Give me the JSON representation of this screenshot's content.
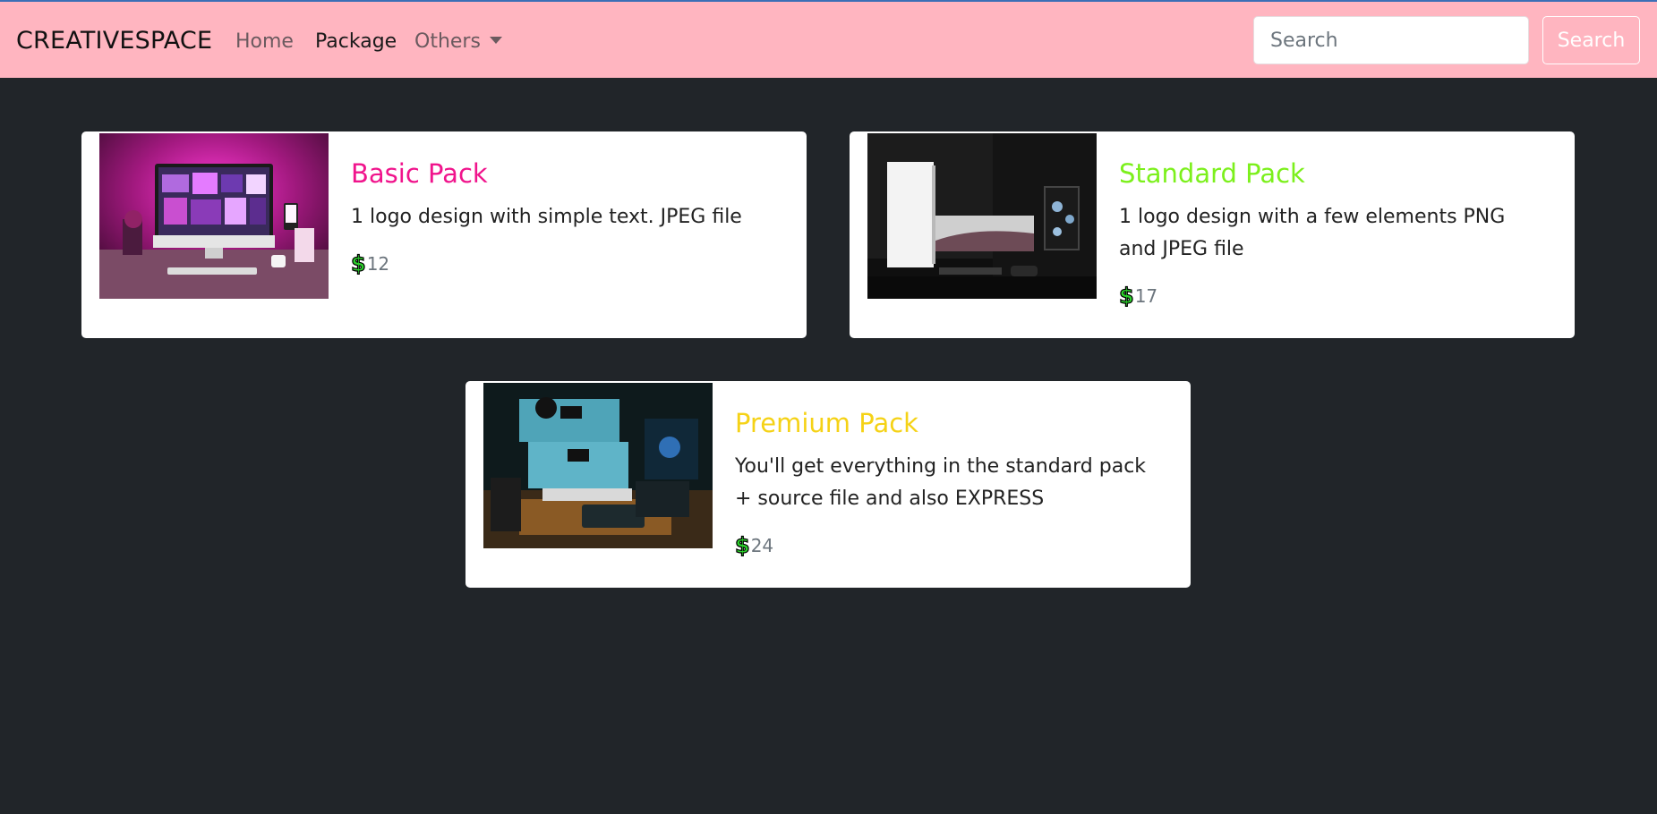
{
  "navbar": {
    "brand": "CREATIVESPACE",
    "links": [
      {
        "label": "Home"
      },
      {
        "label": "Package"
      },
      {
        "label": "Others"
      }
    ],
    "search_placeholder": "Search",
    "search_button": "Search",
    "background": "#ffb5c0"
  },
  "cards": [
    {
      "title": "Basic Pack",
      "title_color": "#f0148c",
      "description": "1 logo design with simple text. JPEG file",
      "currency_icon": "dollar-icon",
      "price": "12"
    },
    {
      "title": "Standard Pack",
      "title_color": "#7cf01c",
      "description": "1 logo design with a few elements PNG and JPEG file",
      "currency_icon": "dollar-icon",
      "price": "17"
    },
    {
      "title": "Premium Pack",
      "title_color": "#f5d216",
      "description": "You'll get everything in the standard pack + source file and also EXPRESS",
      "currency_icon": "dollar-icon",
      "price": "24"
    }
  ],
  "page_background": "#212529"
}
